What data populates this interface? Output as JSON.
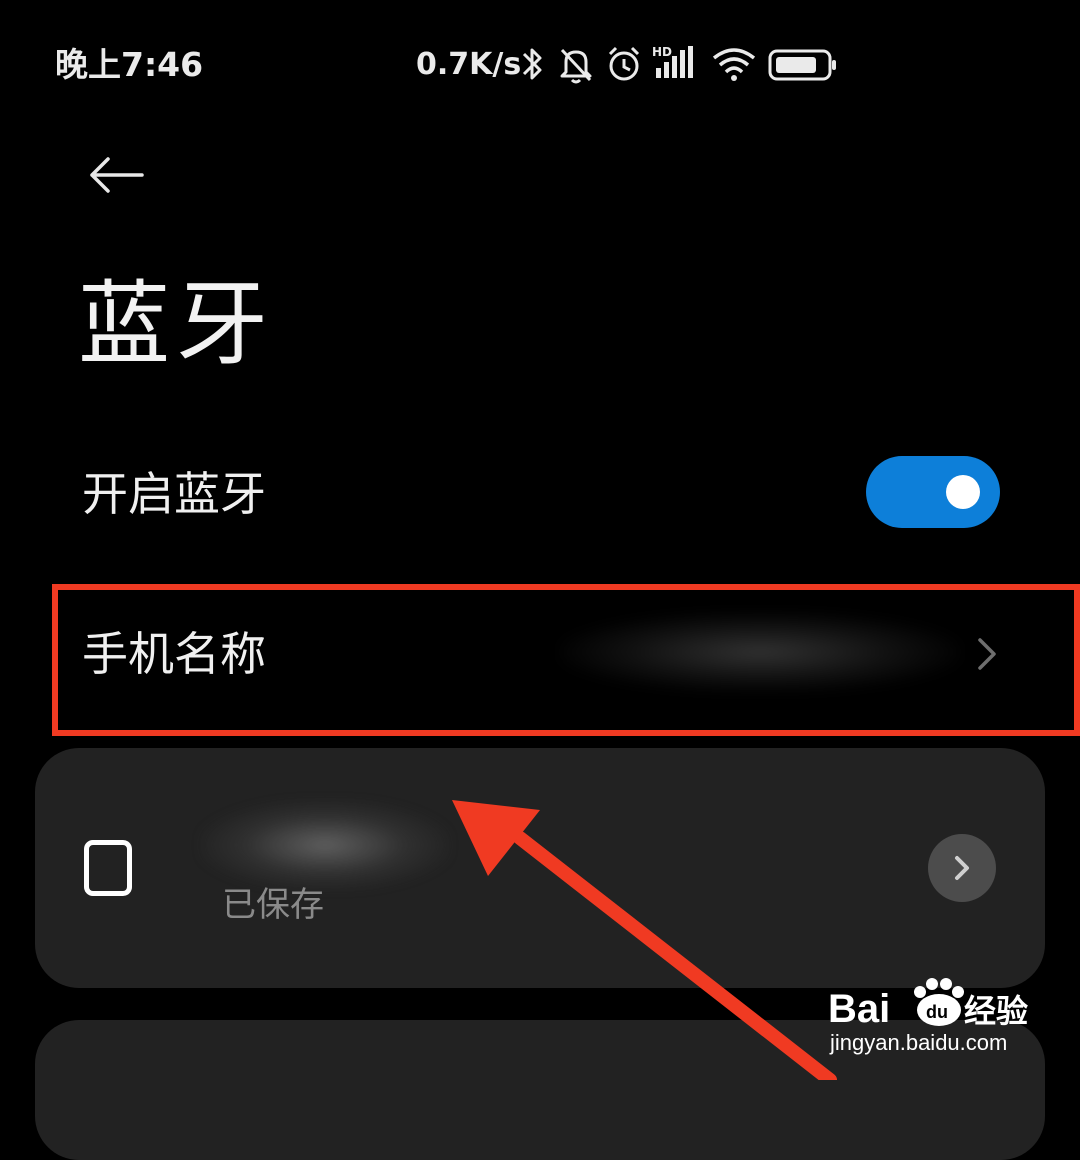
{
  "status_bar": {
    "time": "晚上7:46",
    "net_speed": "0.7K/s",
    "icons": [
      "bluetooth-icon",
      "bell-off-icon",
      "alarm-clock-icon",
      "hd-signal-icon",
      "wifi-icon",
      "battery-icon"
    ],
    "signal_badge": "HD"
  },
  "header": {
    "back_icon": "arrow-left-icon",
    "title": "蓝牙"
  },
  "bluetooth_toggle": {
    "label": "开启蓝牙",
    "enabled": true,
    "color": "#0d7fd9"
  },
  "phone_name": {
    "label": "手机名称",
    "value_obscured": true
  },
  "paired_device": {
    "icon": "device-square-icon",
    "name_obscured": true,
    "status": "已保存",
    "detail_icon": "chevron-right-icon"
  },
  "annotation": {
    "highlight_color": "#f03a22"
  },
  "watermark": {
    "logo": "Baidu经验",
    "url": "jingyan.baidu.com"
  }
}
